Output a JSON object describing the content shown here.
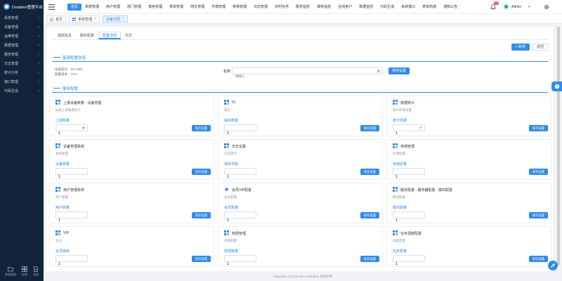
{
  "app": {
    "logo_text": "Dvadmin管理平台"
  },
  "colors": {
    "primary": "#2d8cf0",
    "sidebar": "#13233a",
    "badge": "#f5423f",
    "avatar": "#22b35e"
  },
  "sidebar": {
    "items": [
      "系统管理",
      "设备管理",
      "运维管理",
      "数据管理",
      "服务管理",
      "日志管理",
      "统计分析",
      "接口管理",
      "代码生成"
    ],
    "footer": [
      {
        "label": "系统监控",
        "icon": "folder-icon"
      },
      {
        "label": "应用",
        "icon": "apps-icon"
      },
      {
        "label": "文档",
        "icon": "document-icon"
      }
    ]
  },
  "topnav": {
    "items": [
      {
        "label": "首页",
        "active": true
      },
      {
        "label": "系统管理"
      },
      {
        "label": "用户管理"
      },
      {
        "label": "部门管理"
      },
      {
        "label": "角色管理"
      },
      {
        "label": "菜单管理"
      },
      {
        "label": "岗位管理"
      },
      {
        "label": "字典管理"
      },
      {
        "label": "参数管理"
      },
      {
        "label": "日志管理"
      },
      {
        "label": "定时任务"
      },
      {
        "label": "服务监控"
      },
      {
        "label": "缓存监控"
      },
      {
        "label": "在线用户"
      },
      {
        "label": "数据监控"
      },
      {
        "label": "代码生成"
      },
      {
        "label": "系统接口"
      },
      {
        "label": "表单构建"
      },
      {
        "label": "通知公告"
      }
    ],
    "notification_count": "99",
    "user_name": "Admin"
  },
  "tags": [
    {
      "label": "首页",
      "icon": "home-icon"
    },
    {
      "label": "系统管理",
      "icon": "grid-icon",
      "closable": true
    },
    {
      "label": "设备详情",
      "closable": true,
      "active": true
    }
  ],
  "subtabs": [
    {
      "label": "基础信息"
    },
    {
      "label": "服务配置"
    },
    {
      "label": "配置详情",
      "active": true
    },
    {
      "label": "日志"
    }
  ],
  "actions": {
    "add_label": "+ 新增",
    "back_label": "返回"
  },
  "basic": {
    "title": "基础配置信息",
    "lines": [
      "设备型号：DV-1001",
      "配置版本：V1.0"
    ],
    "name_label": "名称",
    "name_placeholder": "请输入",
    "suffix": "周",
    "save_label": "保存设置"
  },
  "service": {
    "title": "服务配置",
    "cards": [
      {
        "icon": "grid-icon",
        "title": "上报设备数量 · 设备管理",
        "subtitle": "设备上报数量统计",
        "label": "上报数量",
        "value": "1",
        "unit": "件",
        "button": "保存设置"
      },
      {
        "icon": "grid-icon",
        "title": "IO",
        "subtitle": "输出",
        "label": "输出数量",
        "value": "1",
        "button": "保存设置"
      },
      {
        "icon": "grid-icon",
        "title": "数据统计",
        "subtitle": "统计周期设置",
        "label": "统计周期",
        "value": "1",
        "unit": "个",
        "button": "保存设置"
      },
      {
        "icon": "grid-icon",
        "title": "设备管理系统",
        "subtitle": "系统配置",
        "label": "设备数量",
        "value": "1",
        "button": "保存设置"
      },
      {
        "icon": "grid-icon",
        "title": "日志设置",
        "subtitle": "日志保存",
        "label": "保存天数",
        "value": "1",
        "button": "保存设置"
      },
      {
        "icon": "grid-icon",
        "title": "存储管理",
        "subtitle": "存储配置",
        "label": "存储容量",
        "value": "1",
        "button": "保存设置"
      },
      {
        "icon": "grid-icon",
        "title": "用户管理系统",
        "subtitle": "用户配置",
        "label": "用户数量",
        "value": "1",
        "button": "保存设置"
      },
      {
        "icon": "diamond-icon",
        "title": "会员VIP配置",
        "subtitle": "会员配置",
        "label": "会员数量",
        "value": "1",
        "button": "保存设置"
      },
      {
        "icon": "grid-icon",
        "title": "服务配置 - 服务器配置 - 模块配置",
        "subtitle": "模块配置",
        "label": "模块数量",
        "value": "1",
        "button": "保存设置"
      },
      {
        "icon": "grid-icon",
        "title": "VIP",
        "subtitle": "会员",
        "label": "会员等级",
        "value": "1",
        "button": "保存设置"
      },
      {
        "icon": "grid-icon",
        "title": "权限管理",
        "subtitle": "权限配置",
        "label": "权限数量",
        "value": "1",
        "button": "保存设置"
      },
      {
        "icon": "grid-icon",
        "title": "任务调度配置",
        "subtitle": "调度配置",
        "label": "任务数量",
        "value": "1",
        "button": "保存设置"
      }
    ]
  },
  "footer": {
    "text": "Copyright © 2018-2024 Dvadmin 版权所有"
  }
}
